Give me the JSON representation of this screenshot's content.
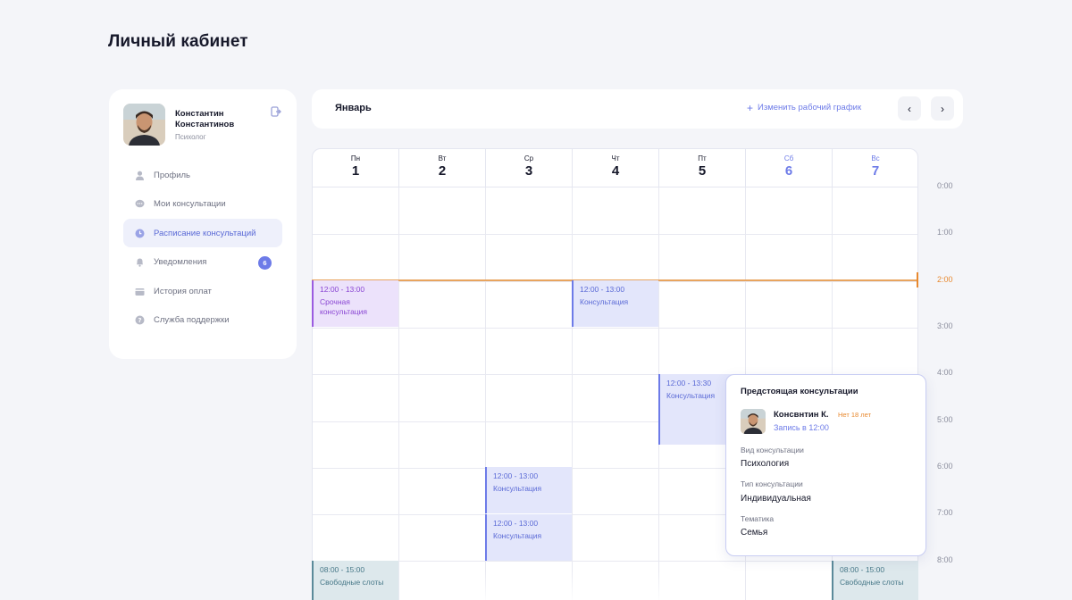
{
  "page": {
    "title": "Личный кабинет"
  },
  "profile": {
    "name": "Константин Константинов",
    "role": "Психолог"
  },
  "sidebar": {
    "items": [
      {
        "label": "Профиль",
        "icon": "user-icon",
        "active": false
      },
      {
        "label": "Мои консультации",
        "icon": "chat-icon",
        "active": false
      },
      {
        "label": "Расписание консультаций",
        "icon": "clock-icon",
        "active": true
      },
      {
        "label": "Уведомления",
        "icon": "bell-icon",
        "active": false,
        "badge": "6"
      },
      {
        "label": "История оплат",
        "icon": "wallet-icon",
        "active": false
      },
      {
        "label": "Служба поддержки",
        "icon": "help-icon",
        "active": false
      }
    ]
  },
  "month_bar": {
    "month": "Январь",
    "edit_label": "Изменить рабочий график",
    "prev": "‹",
    "next": "›"
  },
  "calendar": {
    "days": [
      {
        "name": "Пн",
        "date": "1",
        "weekend": false
      },
      {
        "name": "Вт",
        "date": "2",
        "weekend": false
      },
      {
        "name": "Ср",
        "date": "3",
        "weekend": false
      },
      {
        "name": "Чт",
        "date": "4",
        "weekend": false
      },
      {
        "name": "Пт",
        "date": "5",
        "weekend": false
      },
      {
        "name": "Сб",
        "date": "6",
        "weekend": true
      },
      {
        "name": "Вс",
        "date": "7",
        "weekend": true
      }
    ],
    "hours": [
      "0:00",
      "1:00",
      "2:00",
      "3:00",
      "4:00",
      "5:00",
      "6:00",
      "7:00",
      "8:00"
    ],
    "current_hour": "2:00",
    "events": [
      {
        "day": 0,
        "row": 2,
        "time": "12:00 - 13:00",
        "title": "Срочная консультация",
        "kind": "urgent"
      },
      {
        "day": 3,
        "row": 2,
        "time": "12:00 - 13:00",
        "title": "Консультация",
        "kind": "regular"
      },
      {
        "day": 4,
        "row": 4,
        "time": "12:00 - 13:30",
        "title": "Консультация",
        "kind": "regular"
      },
      {
        "day": 2,
        "row": 6,
        "time": "12:00 - 13:00",
        "title": "Консультация",
        "kind": "regular"
      },
      {
        "day": 2,
        "row": 7,
        "time": "12:00 - 13:00",
        "title": "Консультация",
        "kind": "regular"
      },
      {
        "day": 0,
        "row": 8,
        "time": "08:00 - 15:00",
        "title": "Свободные слоты",
        "kind": "free"
      },
      {
        "day": 6,
        "row": 8,
        "time": "08:00 - 15:00",
        "title": "Свободные слоты",
        "kind": "free"
      }
    ]
  },
  "popover": {
    "title": "Предстоящая консультации",
    "client_name": "Консвнтин К.",
    "client_age": "Нет 18 лет",
    "appointment": "Запись в 12:00",
    "type_label": "Вид консультации",
    "type_value": "Психология",
    "format_label": "Тип консультации",
    "format_value": "Индивидуальная",
    "topic_label": "Тематика",
    "topic_value": "Семья"
  },
  "colors": {
    "accent": "#6d7be8",
    "urgent": "#9b5be0",
    "free": "#5b8a9a",
    "now_line": "#e8892f"
  }
}
